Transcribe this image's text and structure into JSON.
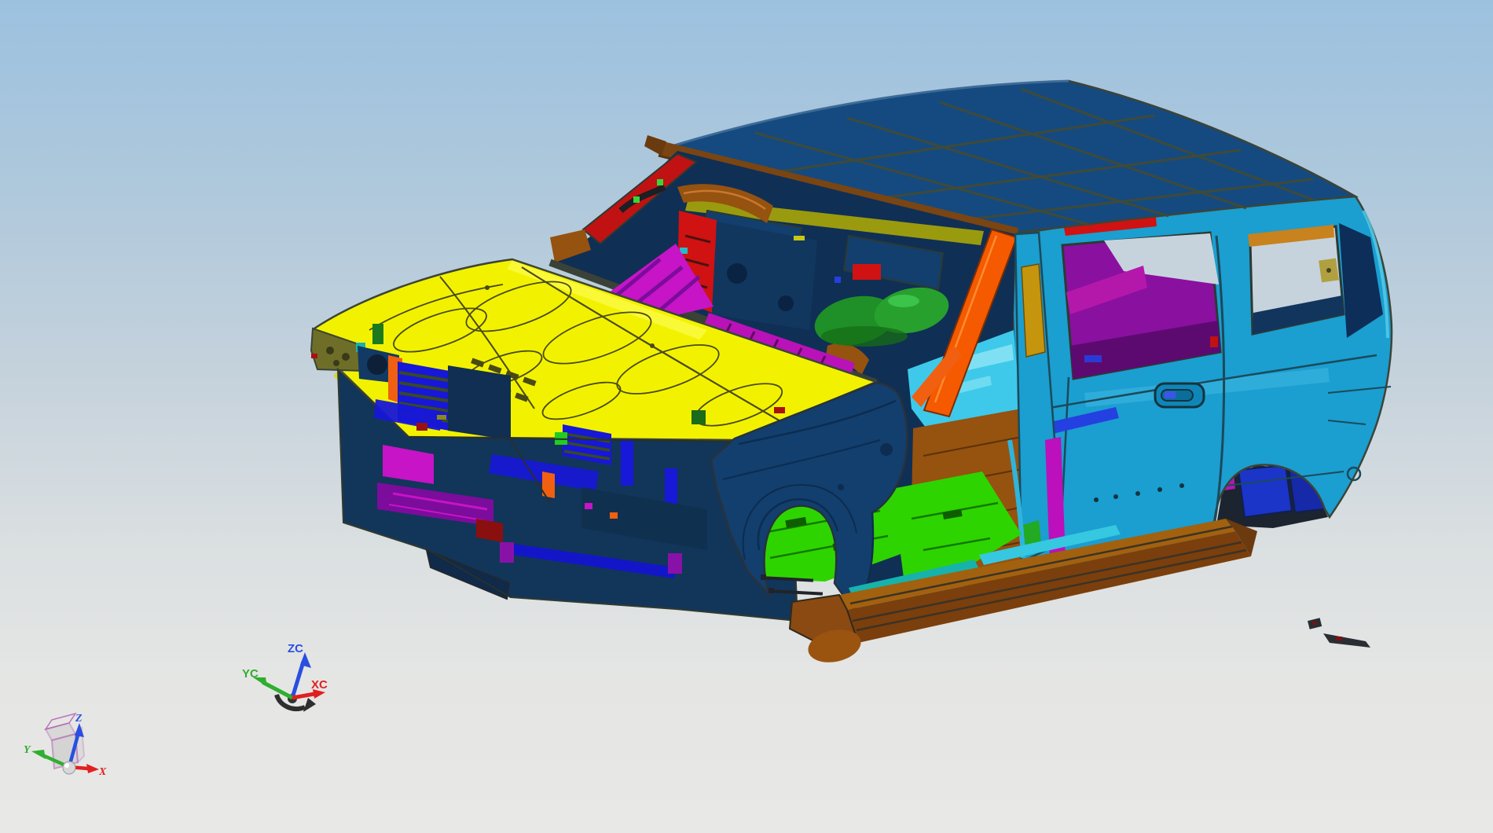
{
  "viewport": {
    "type": "cad-3d-viewport",
    "background_top": "#9cc1df",
    "background_bottom": "#e8e8e6"
  },
  "wcs_triad": {
    "z_label": "ZC",
    "y_label": "YC",
    "x_label": "XC",
    "z_color": "#2a4ee0",
    "y_color": "#2fae2f",
    "x_color": "#e02020",
    "base_color": "#2e2e2e"
  },
  "view_axes": {
    "z_label": "Z",
    "y_label": "Y",
    "x_label": "X",
    "z_color": "#2a4ee0",
    "y_color": "#2fae2f",
    "x_color": "#e02020",
    "cube_edge": "#b467b4",
    "cube_face": "#c8c8c8",
    "sphere": "#d8d8d8"
  },
  "palette": {
    "outline": "#3c4437",
    "roof_blue": "#154a80",
    "roof_line": "#3f4a38",
    "rail_brown": "#7a4512",
    "rail_dark": "#5a330e",
    "hood_yellow": "#f2f200",
    "hood_shade": "#d8da00",
    "hood_hi": "#ffff66",
    "hood_line": "#4a4a14",
    "olive": "#9a9a0e",
    "olive_dark": "#6e6e28",
    "body_cyan": "#1b9ed0",
    "cyan_hi": "#43bfe6",
    "cyan_dk": "#0d6f9c",
    "cyan_line": "#1b4a5a",
    "fender_navy": "#123f6e",
    "navy_dark": "#0d2c50",
    "interior_navy": "#102f55",
    "red": "#d01212",
    "red_dark": "#c01212",
    "maroon": "#8a0f0f",
    "magenta": "#c614c6",
    "magenta_deep": "#b018b0",
    "purple": "#7c0c9c",
    "violet_slab": "#8a10a0",
    "violet_roll": "#b418ab",
    "orange": "#f55a00",
    "orange2": "#f06010",
    "tan_orange": "#c8821e",
    "gold": "#c6950e",
    "khaki": "#b0a040",
    "seat_green": "#1f8f28",
    "green_dark": "#156e15",
    "green_mid": "#22aa22",
    "bright_green": "#2ed400",
    "blue_bright": "#1717d8",
    "blue_deep": "#1b35c8",
    "blue_accent": "#2440e0",
    "teal": "#17b2ac",
    "cyan_floor": "#3ec9ea",
    "floor_brown": "#96520f",
    "rocker_top": "#a2610f",
    "rocker_face": "#7a3f0c",
    "rocker_brown": "#8a4a12",
    "sky_through": "#c6d3dd",
    "fragment_dark": "#2a2d31",
    "white": "#e8e8e8"
  },
  "model": {
    "name": "suv-body-in-white",
    "parts": [
      {
        "name": "roof-panel",
        "color": "#154a80"
      },
      {
        "name": "windshield-header-rail",
        "color": "#7a4512"
      },
      {
        "name": "hood-panel",
        "color": "#f2f200"
      },
      {
        "name": "rear-body-side",
        "color": "#1b9ed0"
      },
      {
        "name": "front-fender",
        "color": "#123f6e"
      },
      {
        "name": "rocker-panel",
        "color": "#8a4a12"
      },
      {
        "name": "front-floor",
        "color": "#3ec9ea"
      },
      {
        "name": "center-floor",
        "color": "#96520f"
      },
      {
        "name": "floor-reinforcement",
        "color": "#2ed400"
      },
      {
        "name": "a-pillar-frame",
        "color": "#f55a00"
      },
      {
        "name": "b-pillar",
        "color": "#1b9ed0"
      },
      {
        "name": "b-pillar-reinforcement",
        "color": "#c6950e"
      },
      {
        "name": "left-a-pillar-inner",
        "color": "#c01212"
      },
      {
        "name": "cowl-vent-panel",
        "color": "#c614c6"
      },
      {
        "name": "seat-structure",
        "color": "#1f8f28"
      },
      {
        "name": "quarter-trim-panel",
        "color": "#8a10a0"
      },
      {
        "name": "radiator-grille",
        "color": "#1717d8"
      },
      {
        "name": "bumper-bracket",
        "color": "#7c0c9c"
      },
      {
        "name": "cantrail-strip",
        "color": "#d01212"
      },
      {
        "name": "wheelhouse-box",
        "color": "#1b35c8"
      }
    ]
  }
}
